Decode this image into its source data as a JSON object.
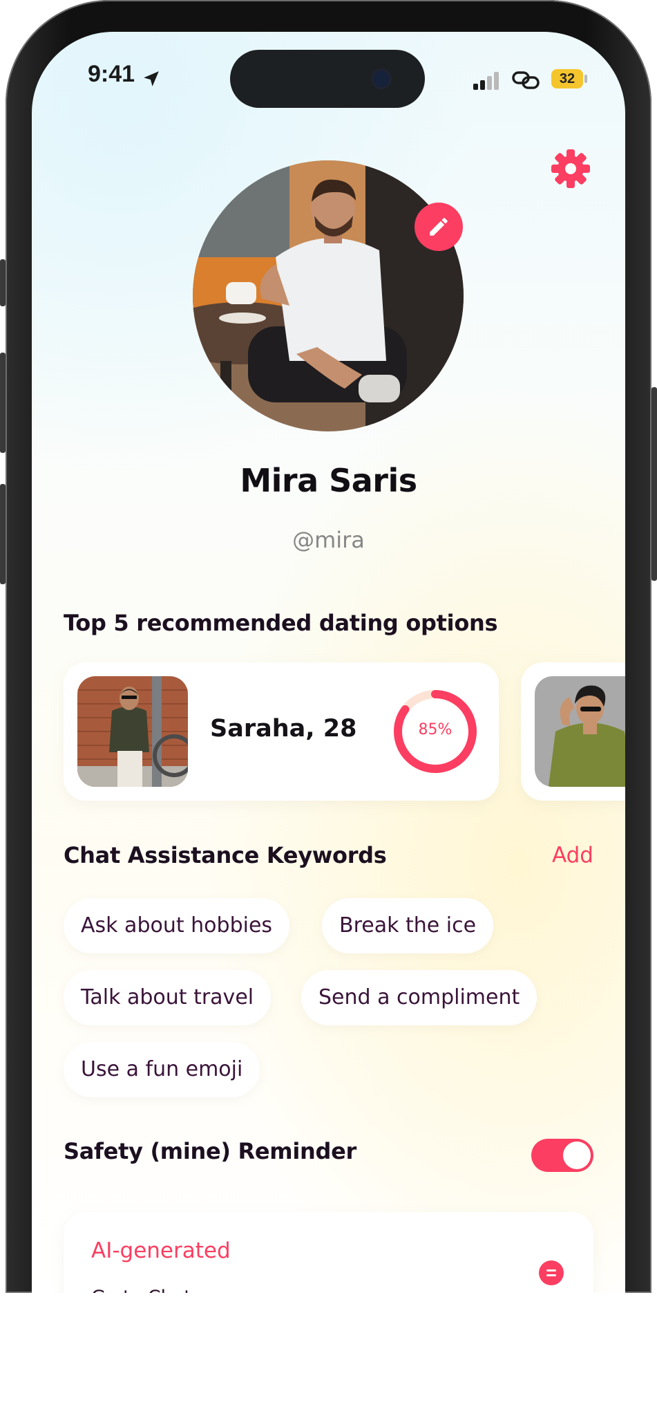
{
  "status_bar": {
    "time": "9:41",
    "battery": "32"
  },
  "profile": {
    "name": "Mira Saris",
    "handle": "@mira"
  },
  "recommendations": {
    "title": "Top 5 recommended dating options",
    "matches": [
      {
        "name": "Saraha, 28",
        "match_percent_label": "85%",
        "match_fraction": 0.85
      },
      {
        "name": "",
        "match_percent_label": "",
        "match_fraction": 0
      }
    ]
  },
  "keywords": {
    "title": "Chat Assistance Keywords",
    "add_label": "Add",
    "chips": [
      "Ask about hobbies",
      "Break the ice",
      "Talk about travel",
      "Send a compliment",
      "Use a fun emoji"
    ]
  },
  "safety": {
    "title": "Safety (mine) Reminder",
    "enabled": true
  },
  "ai_card": {
    "title": "AI-generated",
    "link": "Go to Chat"
  },
  "colors": {
    "accent": "#fb3e61",
    "text_dark": "#1c1020",
    "chip_text": "#3a1439",
    "muted": "#878787",
    "battery": "#f5c52d"
  },
  "icons": {
    "location": "location-arrow-icon",
    "signal": "cellular-signal-icon",
    "link": "chain-link-icon",
    "settings": "gear-icon",
    "edit": "pencil-icon",
    "chat": "chat-bubble-icon"
  }
}
